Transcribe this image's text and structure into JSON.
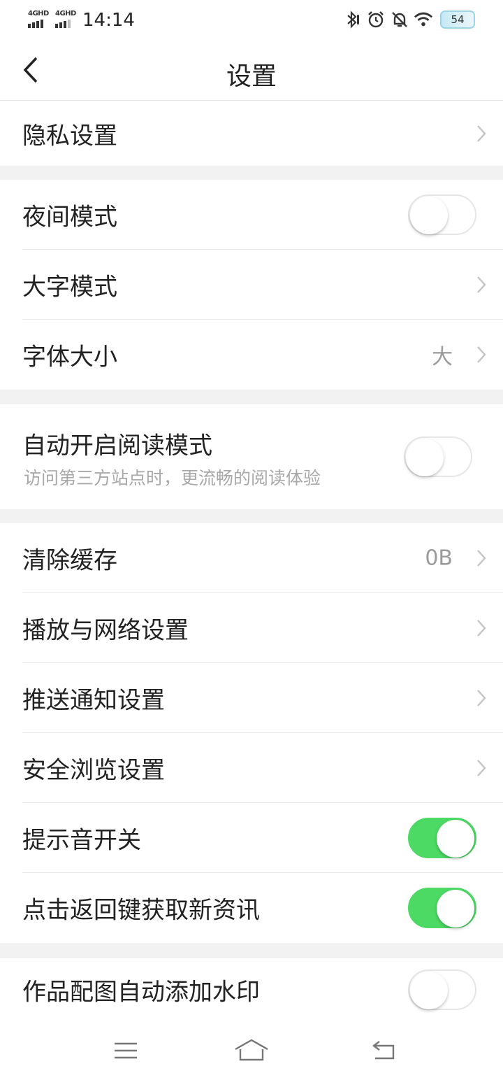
{
  "status_bar": {
    "network_1": "4GHD",
    "network_2": "4GHD",
    "time": "14:14",
    "battery": "54",
    "icons": [
      "bluetooth-icon",
      "alarm-icon",
      "mute-bell-icon",
      "wifi-icon"
    ]
  },
  "nav": {
    "title": "设置",
    "back_icon": "chevron-left-icon"
  },
  "sections": {
    "privacy": {
      "label": "隐私设置"
    },
    "night_mode": {
      "label": "夜间模式",
      "on": false
    },
    "large_text": {
      "label": "大字模式"
    },
    "font_size": {
      "label": "字体大小",
      "value": "大"
    },
    "auto_reading": {
      "label": "自动开启阅读模式",
      "sub": "访问第三方站点时，更流畅的阅读体验",
      "on": false
    },
    "clear_cache": {
      "label": "清除缓存",
      "value": "0B"
    },
    "playback_network": {
      "label": "播放与网络设置"
    },
    "push_notify": {
      "label": "推送通知设置"
    },
    "safe_browse": {
      "label": "安全浏览设置"
    },
    "sound_switch": {
      "label": "提示音开关",
      "on": true
    },
    "back_refresh": {
      "label": "点击返回键获取新资讯",
      "on": true
    },
    "watermark": {
      "label": "作品配图自动添加水印",
      "on": false
    }
  },
  "bottom_nav": [
    "menu-icon",
    "home-icon",
    "back-icon"
  ],
  "colors": {
    "toggle_on": "#4cd964",
    "page_bg": "#f2f2f2"
  }
}
